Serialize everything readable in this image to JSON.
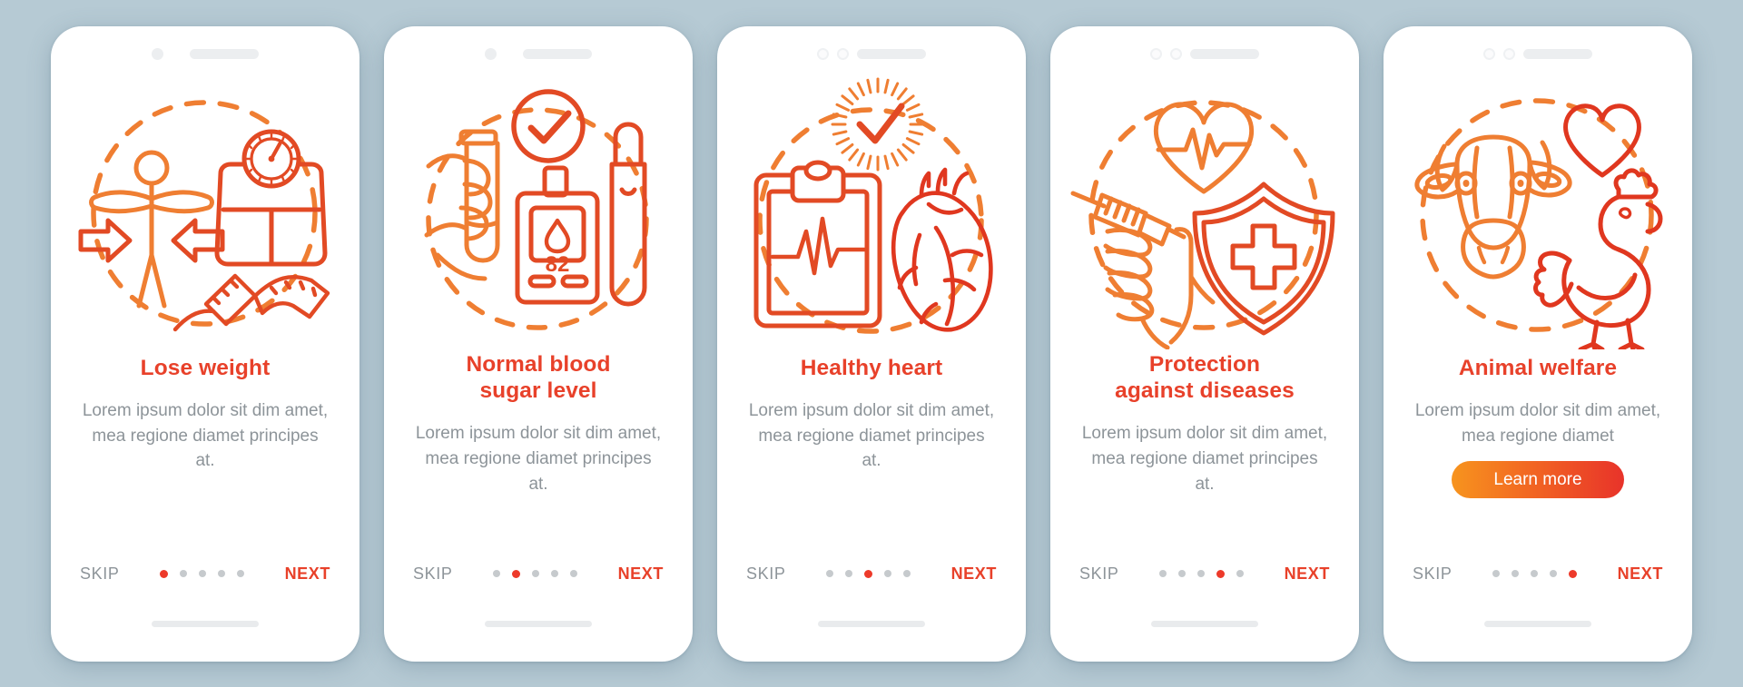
{
  "background_color": "#b6cad4",
  "theme": {
    "accent_red": "#e8412a",
    "accent_orange": "#f7941e",
    "muted_text": "#8d9499",
    "dot_inactive": "#c6cacd",
    "dot_active": "#ed3a2a",
    "card_background": "#ffffff"
  },
  "common": {
    "skip_label": "SKIP",
    "next_label": "NEXT",
    "body_text_3line": "Lorem ipsum dolor sit dim amet, mea regione diamet principes at.",
    "body_text_2line": "Lorem ipsum dolor sit dim amet, mea regione diamet",
    "total_steps": 5
  },
  "screens": [
    {
      "index": 1,
      "title": "Lose weight",
      "title_lines": [
        "Lose weight"
      ],
      "description": "Lorem ipsum dolor sit dim amet, mea regione diamet principes at.",
      "skip_label": "SKIP",
      "next_label": "NEXT",
      "active_dot": 1,
      "has_learn_more": false,
      "learn_more_label": "",
      "topbar_style": "dot-pill",
      "illustration": {
        "name": "lose-weight-illustration",
        "elements": [
          "person-with-arrows-icon",
          "bathroom-scale-icon",
          "measuring-tape-icon",
          "dashed-circle"
        ]
      }
    },
    {
      "index": 2,
      "title": "Normal blood sugar level",
      "title_lines": [
        "Normal blood",
        "sugar level"
      ],
      "description": "Lorem ipsum dolor sit dim amet, mea regione diamet principes at.",
      "skip_label": "SKIP",
      "next_label": "NEXT",
      "active_dot": 2,
      "has_learn_more": false,
      "learn_more_label": "",
      "topbar_style": "dot-pill",
      "illustration": {
        "name": "blood-sugar-illustration",
        "elements": [
          "hand-holding-vial-icon",
          "glucose-meter-icon",
          "lancet-pen-icon",
          "checkmark-circle-icon",
          "dashed-circle"
        ],
        "meter_reading": "82"
      }
    },
    {
      "index": 3,
      "title": "Healthy heart",
      "title_lines": [
        "Healthy heart"
      ],
      "description": "Lorem ipsum dolor sit dim amet, mea regione diamet principes at.",
      "skip_label": "SKIP",
      "next_label": "NEXT",
      "active_dot": 3,
      "has_learn_more": false,
      "learn_more_label": "",
      "topbar_style": "tworing-pill",
      "illustration": {
        "name": "healthy-heart-illustration",
        "elements": [
          "clipboard-ecg-icon",
          "anatomical-heart-icon",
          "checkmark-rays-icon",
          "dashed-circle"
        ]
      }
    },
    {
      "index": 4,
      "title": "Protection against diseases",
      "title_lines": [
        "Protection",
        "against diseases"
      ],
      "description": "Lorem ipsum dolor sit dim amet, mea regione diamet principes at.",
      "skip_label": "SKIP",
      "next_label": "NEXT",
      "active_dot": 4,
      "has_learn_more": false,
      "learn_more_label": "",
      "topbar_style": "tworing-pill",
      "illustration": {
        "name": "protection-illustration",
        "elements": [
          "heart-pulse-icon",
          "hand-with-syringe-icon",
          "shield-medical-cross-icon",
          "dashed-circle"
        ]
      }
    },
    {
      "index": 5,
      "title": "Animal welfare",
      "title_lines": [
        "Animal welfare"
      ],
      "description": "Lorem ipsum dolor sit dim amet, mea regione diamet",
      "skip_label": "SKIP",
      "next_label": "NEXT",
      "active_dot": 5,
      "has_learn_more": true,
      "learn_more_label": "Learn more",
      "topbar_style": "tworing-pill",
      "illustration": {
        "name": "animal-welfare-illustration",
        "elements": [
          "cow-head-icon",
          "heart-outline-icon",
          "chicken-icon",
          "dashed-circle"
        ]
      }
    }
  ]
}
